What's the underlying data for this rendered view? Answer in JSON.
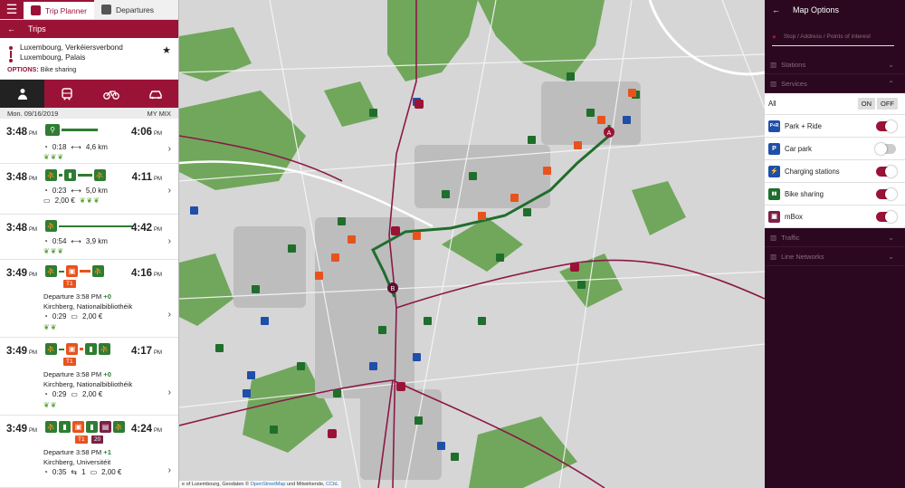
{
  "topbar": {
    "tabs": [
      {
        "label": "Trip Planner"
      },
      {
        "label": "Departures"
      }
    ]
  },
  "trips_header": {
    "title": "Trips"
  },
  "route": {
    "from": "Luxembourg, Verkéiersverbond",
    "to": "Luxembourg, Palais",
    "options_label": "OPTIONS:",
    "options_value": "Bike sharing"
  },
  "date_line": {
    "date": "Mon. 09/16/2019",
    "profile": "MY MIX"
  },
  "trips": [
    {
      "dep": "3:48",
      "arr": "4:06",
      "meridiem": "PM",
      "duration": "0:18",
      "distance": "4,6 km"
    },
    {
      "dep": "3:48",
      "arr": "4:11",
      "meridiem": "PM",
      "duration": "0:23",
      "distance": "5,0 km",
      "price": "2,00 €"
    },
    {
      "dep": "3:48",
      "arr": "4:42",
      "meridiem": "PM",
      "duration": "0:54",
      "distance": "3,9 km"
    },
    {
      "dep": "3:49",
      "arr": "4:16",
      "meridiem": "PM",
      "line": "T1",
      "departure": "Departure 3:58 PM",
      "delay": "+0",
      "stop": "Kirchberg, Nationalbibliothéik",
      "duration": "0:29",
      "price": "2,00 €"
    },
    {
      "dep": "3:49",
      "arr": "4:17",
      "meridiem": "PM",
      "line": "T1",
      "departure": "Departure 3:58 PM",
      "delay": "+0",
      "stop": "Kirchberg, Nationalbibliothéik",
      "duration": "0:29",
      "price": "2,00 €"
    },
    {
      "dep": "3:49",
      "arr": "4:24",
      "meridiem": "PM",
      "line": "T1",
      "line2": "20",
      "departure": "Departure 3:58 PM",
      "delay": "+1",
      "stop": "Kirchberg, Universitéit",
      "duration": "0:35",
      "changes": "1",
      "price": "2,00 €"
    }
  ],
  "map": {
    "marker_a": "A",
    "marker_b": "B",
    "attribution_prefix": "e of Luxembourg, Geodaten ©",
    "attribution_osm": "OpenStreetMap",
    "attribution_mid": "und Mitwirkende,",
    "attribution_cc": "CCbL"
  },
  "map_options": {
    "title": "Map Options",
    "search_placeholder": "Stop / Address / Points of interest",
    "sections": {
      "stations": "Stations",
      "services": "Services",
      "traffic": "Traffic",
      "line_networks": "Line Networks"
    },
    "all_label": "All",
    "on_label": "ON",
    "off_label": "OFF",
    "services": [
      {
        "label": "Park + Ride",
        "on": true,
        "icon": "park-ride-icon",
        "color": "#1f4fa8",
        "glyph": "P+R"
      },
      {
        "label": "Car park",
        "on": false,
        "icon": "car-park-icon",
        "color": "#1f4fa8",
        "glyph": "P"
      },
      {
        "label": "Charging stations",
        "on": true,
        "icon": "charging-station-icon",
        "color": "#1f4fa8",
        "glyph": "⚡"
      },
      {
        "label": "Bike sharing",
        "on": true,
        "icon": "bike-sharing-icon",
        "color": "#1f6e2c",
        "glyph": "▮▮"
      },
      {
        "label": "mBox",
        "on": true,
        "icon": "mbox-icon",
        "color": "#7b2146",
        "glyph": "▣"
      }
    ]
  },
  "colors": {
    "brand": "#9a1337",
    "route": "#1f6e2c",
    "bus": "#e8531d",
    "panel": "#2b0820"
  }
}
